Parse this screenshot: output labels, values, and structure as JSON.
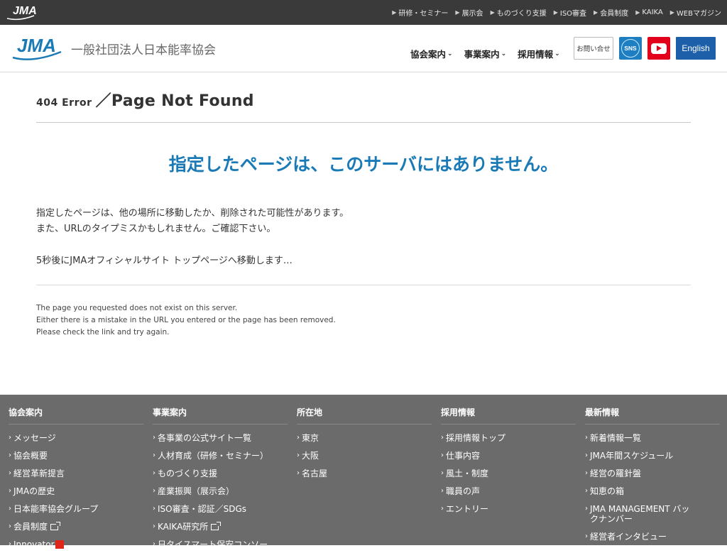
{
  "topbar": {
    "logo_text": "JMA",
    "links": [
      "研修・セミナー",
      "展示会",
      "ものづくり支援",
      "ISO審査",
      "会員制度",
      "KAIKA",
      "WEBマガジン"
    ]
  },
  "header": {
    "logo_text": "JMA",
    "brand_name": "一般社団法人日本能率協会",
    "nav": [
      "協会案内",
      "事業案内",
      "採用情報"
    ],
    "contact_label": "お問い合せ",
    "sns_label": "SNS",
    "english_label": "English"
  },
  "main": {
    "title_small": "404 Error",
    "title_sep": "／",
    "title_big": "Page Not Found",
    "headline": "指定したページは、このサーバにはありません。",
    "jp_line1": "指定したページは、他の場所に移動したか、削除された可能性があります。",
    "jp_line2": "また、URLのタイプミスかもしれません。ご確認下さい。",
    "redirect": "5秒後にJMAオフィシャルサイト トップページへ移動します…",
    "en_line1": "The page you requested does not exist on this server.",
    "en_line2": "Either there is a mistake in the URL you entered or the page has been removed.",
    "en_line3": "Please check the link and try again."
  },
  "footer": {
    "columns": [
      {
        "heading": "協会案内",
        "items": [
          "メッセージ",
          "協会概要",
          "経営革新提言",
          "JMAの歴史",
          "日本能率協会グループ",
          "会員制度",
          "Innovator"
        ]
      },
      {
        "heading": "事業案内",
        "items": [
          "各事業の公式サイト一覧",
          "人材育成（研修・セミナー）",
          "ものづくり支援",
          "産業振興（展示会）",
          "ISO審査・認証／SDGs",
          "KAIKA研究所",
          "日タイスマート保安コンソー"
        ]
      },
      {
        "heading": "所在地",
        "items": [
          "東京",
          "大阪",
          "名古屋"
        ]
      },
      {
        "heading": "採用情報",
        "items": [
          "採用情報トップ",
          "仕事内容",
          "風土・制度",
          "職員の声",
          "エントリー"
        ]
      },
      {
        "heading": "最新情報",
        "items": [
          "新着情報一覧",
          "JMA年間スケジュール",
          "経営の羅針盤",
          "知恵の箱",
          "JMA MANAGEMENT バックナンバー",
          "経営者インタビュー"
        ]
      }
    ]
  },
  "colors": {
    "topbar_bg": "#3a3a3a",
    "headline": "#1a7ab6",
    "sns": "#1d7ec2",
    "youtube": "#e3001b",
    "english": "#1d5fa8",
    "footer_bg": "#6b6b6b"
  }
}
